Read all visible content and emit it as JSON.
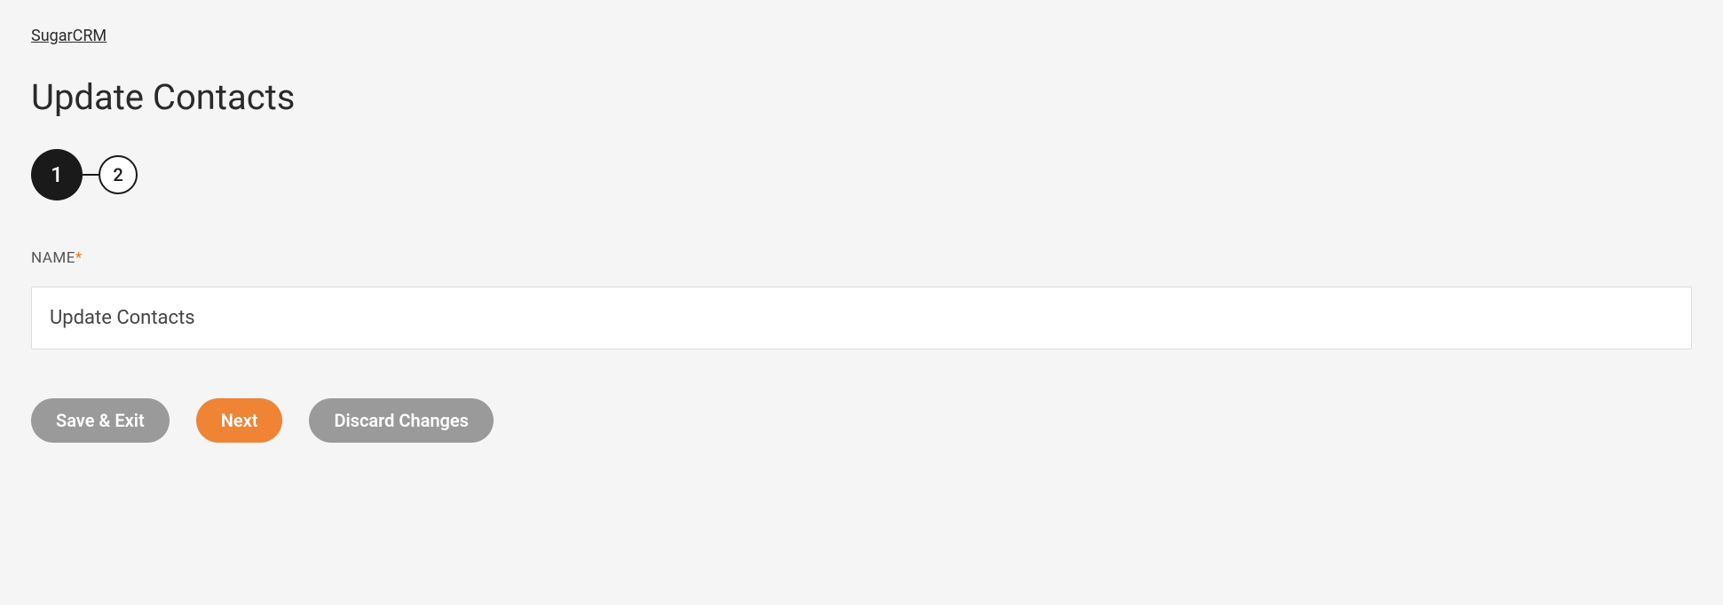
{
  "breadcrumb": {
    "parent_label": "SugarCRM"
  },
  "page": {
    "title": "Update Contacts"
  },
  "stepper": {
    "steps": [
      {
        "label": "1",
        "active": true
      },
      {
        "label": "2",
        "active": false
      }
    ]
  },
  "form": {
    "name_label": "NAME",
    "name_value": "Update Contacts"
  },
  "buttons": {
    "save_exit": "Save & Exit",
    "next": "Next",
    "discard": "Discard Changes"
  }
}
